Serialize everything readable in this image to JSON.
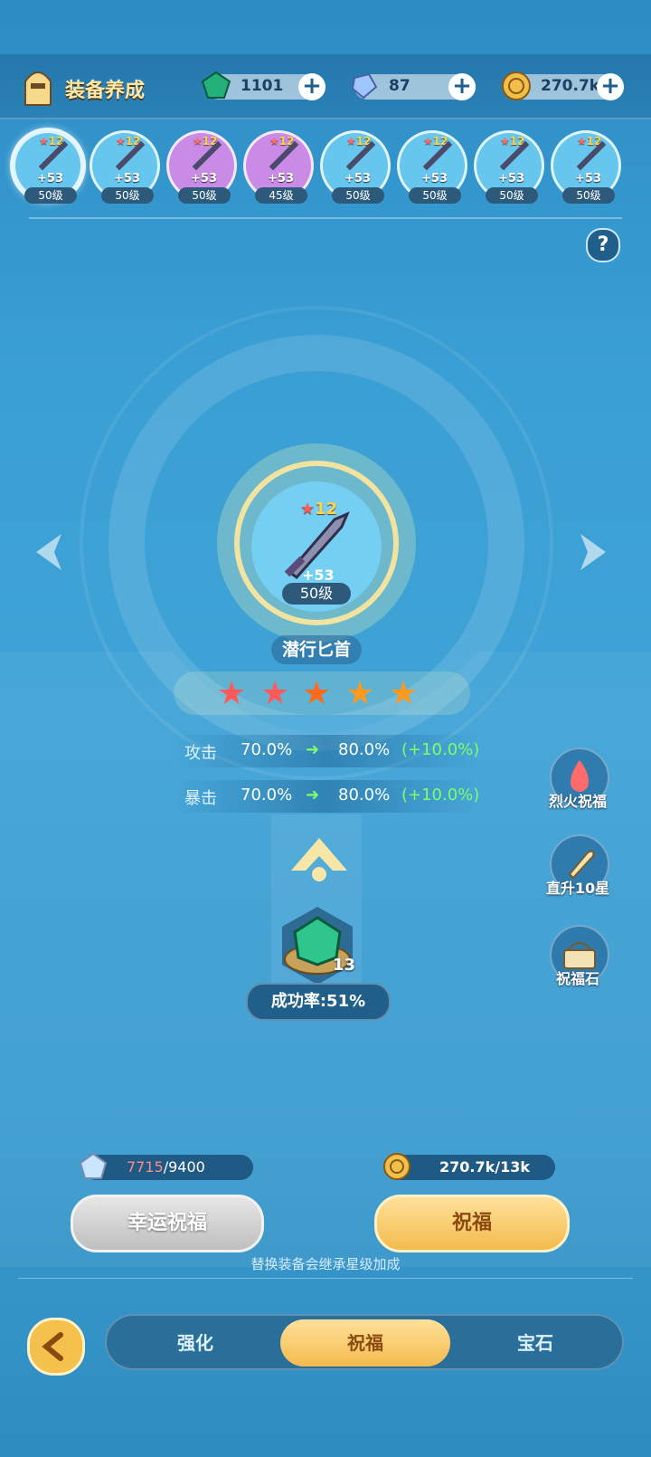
{
  "header": {
    "title": "装备养成",
    "resources": [
      {
        "icon": "green-gem-icon",
        "value": "1101"
      },
      {
        "icon": "crystal-icon",
        "value": "87"
      },
      {
        "icon": "gold-coin-icon",
        "value": "270.7k"
      }
    ]
  },
  "equipment": [
    {
      "stars": "12",
      "plus": "+53",
      "level": "50级",
      "color": "#66c6ee",
      "selected": true
    },
    {
      "stars": "12",
      "plus": "+53",
      "level": "50级",
      "color": "#66c6ee"
    },
    {
      "stars": "12",
      "plus": "+53",
      "level": "50级",
      "color": "#c98be6"
    },
    {
      "stars": "12",
      "plus": "+53",
      "level": "45级",
      "color": "#c98be6"
    },
    {
      "stars": "12",
      "plus": "+53",
      "level": "50级",
      "color": "#66c6ee"
    },
    {
      "stars": "12",
      "plus": "+53",
      "level": "50级",
      "color": "#66c6ee"
    },
    {
      "stars": "12",
      "plus": "+53",
      "level": "50级",
      "color": "#66c6ee"
    },
    {
      "stars": "12",
      "plus": "+53",
      "level": "50级",
      "color": "#66c6ee"
    }
  ],
  "help_label": "?",
  "item": {
    "stars": "12",
    "plus": "+53",
    "level": "50级",
    "name": "潜行匕首",
    "star_rating": {
      "filled": 5,
      "highlight": 3
    }
  },
  "stats": [
    {
      "label": "攻击",
      "from": "70.0%",
      "to": "80.0%",
      "bonus": "(+10.0%)"
    },
    {
      "label": "暴击",
      "from": "70.0%",
      "to": "80.0%",
      "bonus": "(+10.0%)"
    }
  ],
  "material": {
    "count": "13",
    "success_rate": "成功率:51%"
  },
  "side_buttons": [
    {
      "label": "烈火祝福",
      "icon": "fire-icon"
    },
    {
      "label": "直升10星",
      "icon": "rocket-icon"
    },
    {
      "label": "祝福石",
      "icon": "basket-icon"
    }
  ],
  "lucky": {
    "current": "7715",
    "max": "/9400",
    "button": "幸运祝福"
  },
  "gold_cost": {
    "value": "270.7k/13k",
    "button": "祝福"
  },
  "hint": "替换装备会继承星级加成",
  "tabs": [
    "强化",
    "祝福",
    "宝石"
  ],
  "active_tab": 1,
  "colors": {
    "accent": "#f8cf6e",
    "green": "#7cff6a",
    "red_star": "#ff5a5a",
    "orange_star": "#ff9a1e"
  }
}
